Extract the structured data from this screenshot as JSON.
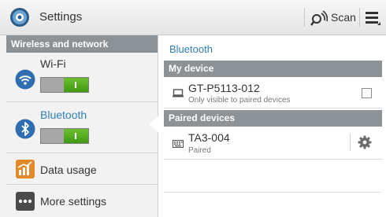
{
  "header": {
    "title": "Settings",
    "app_icon": "settings-gear-icon",
    "scan_label": "Scan",
    "scan_icon": "scan-radar-icon",
    "menu_icon": "overflow-menu-icon"
  },
  "sidebar": {
    "section_title": "Wireless and network",
    "items": [
      {
        "label": "Wi-Fi",
        "icon": "wifi-icon",
        "toggle": "on"
      },
      {
        "label": "Bluetooth",
        "icon": "bluetooth-icon",
        "toggle": "on",
        "selected": true
      },
      {
        "label": "Data usage",
        "icon": "data-usage-chart-icon"
      },
      {
        "label": "More settings",
        "icon": "more-settings-dots-icon"
      }
    ]
  },
  "detail": {
    "title": "Bluetooth",
    "my_device_header": "My device",
    "my_device": {
      "name": "GT-P5113-012",
      "subtitle": "Only visible to paired devices",
      "icon": "tablet-device-icon",
      "checked": false
    },
    "paired_header": "Paired devices",
    "paired": [
      {
        "name": "TA3-004",
        "status": "Paired",
        "icon": "keyboard-icon",
        "action_icon": "gear-icon"
      }
    ]
  },
  "colors": {
    "accent": "#2f7fb6",
    "section_header": "#8c9296",
    "toggle_on": "#4aa51b",
    "sidebar_bg": "#f2f2f2"
  }
}
